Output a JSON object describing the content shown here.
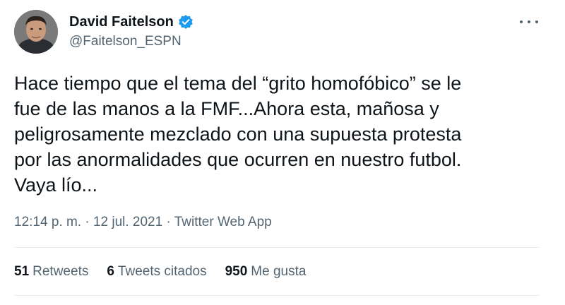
{
  "author": {
    "name": "David Faitelson",
    "handle": "@Faitelson_ESPN",
    "verified_icon": "verified-badge-icon"
  },
  "tweet": {
    "text": "Hace tiempo que el tema del “grito homofóbico” se le\nfue de las manos a la FMF...Ahora esta, mañosa y\npeligrosamente mezclado con una supuesta protesta\npor las anormalidades que ocurren en nuestro futbol.\nVaya lío..."
  },
  "meta": {
    "timestamp": "12:14 p. m. · 12 jul. 2021 · Twitter Web App"
  },
  "stats": {
    "retweets_count": "51",
    "retweets_label": "Retweets",
    "quotes_count": "6",
    "quotes_label": "Tweets citados",
    "likes_count": "950",
    "likes_label": "Me gusta"
  },
  "colors": {
    "verified": "#1d9bf0",
    "secondary_text": "#536471",
    "primary_text": "#0f1419",
    "divider": "#e6ecf0"
  }
}
